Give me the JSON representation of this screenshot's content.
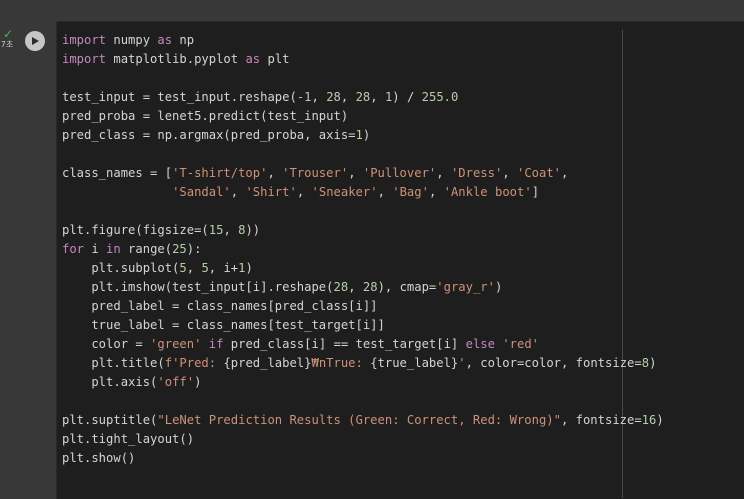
{
  "cell": {
    "status_time": "7초",
    "run_icon": "play-icon",
    "lines": [
      [
        [
          "kw",
          "import"
        ],
        [
          "pl",
          " numpy "
        ],
        [
          "kw",
          "as"
        ],
        [
          "pl",
          " np"
        ]
      ],
      [
        [
          "kw",
          "import"
        ],
        [
          "pl",
          " matplotlib.pyplot "
        ],
        [
          "kw",
          "as"
        ],
        [
          "pl",
          " plt"
        ]
      ],
      [],
      [
        [
          "pl",
          "test_input = test_input.reshape("
        ],
        [
          "num",
          "-1"
        ],
        [
          "pl",
          ", "
        ],
        [
          "num",
          "28"
        ],
        [
          "pl",
          ", "
        ],
        [
          "num",
          "28"
        ],
        [
          "pl",
          ", "
        ],
        [
          "num",
          "1"
        ],
        [
          "pl",
          ") / "
        ],
        [
          "num",
          "255.0"
        ]
      ],
      [
        [
          "pl",
          "pred_proba = lenet5.predict(test_input)"
        ]
      ],
      [
        [
          "pl",
          "pred_class = np.argmax(pred_proba, axis="
        ],
        [
          "num",
          "1"
        ],
        [
          "pl",
          ")"
        ]
      ],
      [],
      [
        [
          "pl",
          "class_names = ["
        ],
        [
          "str",
          "'T-shirt/top'"
        ],
        [
          "pl",
          ", "
        ],
        [
          "str",
          "'Trouser'"
        ],
        [
          "pl",
          ", "
        ],
        [
          "str",
          "'Pullover'"
        ],
        [
          "pl",
          ", "
        ],
        [
          "str",
          "'Dress'"
        ],
        [
          "pl",
          ", "
        ],
        [
          "str",
          "'Coat'"
        ],
        [
          "pl",
          ","
        ]
      ],
      [
        [
          "pl",
          "               "
        ],
        [
          "str",
          "'Sandal'"
        ],
        [
          "pl",
          ", "
        ],
        [
          "str",
          "'Shirt'"
        ],
        [
          "pl",
          ", "
        ],
        [
          "str",
          "'Sneaker'"
        ],
        [
          "pl",
          ", "
        ],
        [
          "str",
          "'Bag'"
        ],
        [
          "pl",
          ", "
        ],
        [
          "str",
          "'Ankle boot'"
        ],
        [
          "pl",
          "]"
        ]
      ],
      [],
      [
        [
          "pl",
          "plt.figure(figsize=("
        ],
        [
          "num",
          "15"
        ],
        [
          "pl",
          ", "
        ],
        [
          "num",
          "8"
        ],
        [
          "pl",
          "))"
        ]
      ],
      [
        [
          "kw",
          "for"
        ],
        [
          "pl",
          " i "
        ],
        [
          "kw",
          "in"
        ],
        [
          "pl",
          " range("
        ],
        [
          "num",
          "25"
        ],
        [
          "pl",
          "):"
        ]
      ],
      [
        [
          "pl",
          "    plt.subplot("
        ],
        [
          "num",
          "5"
        ],
        [
          "pl",
          ", "
        ],
        [
          "num",
          "5"
        ],
        [
          "pl",
          ", i+"
        ],
        [
          "num",
          "1"
        ],
        [
          "pl",
          ")"
        ]
      ],
      [
        [
          "pl",
          "    plt.imshow(test_input[i].reshape("
        ],
        [
          "num",
          "28"
        ],
        [
          "pl",
          ", "
        ],
        [
          "num",
          "28"
        ],
        [
          "pl",
          "), cmap="
        ],
        [
          "str",
          "'gray_r'"
        ],
        [
          "pl",
          ")"
        ]
      ],
      [
        [
          "pl",
          "    pred_label = class_names[pred_class[i]]"
        ]
      ],
      [
        [
          "pl",
          "    true_label = class_names[test_target[i]]"
        ]
      ],
      [
        [
          "pl",
          "    color = "
        ],
        [
          "str",
          "'green'"
        ],
        [
          "pl",
          " "
        ],
        [
          "kw",
          "if"
        ],
        [
          "pl",
          " pred_class[i] == test_target[i] "
        ],
        [
          "kw",
          "else"
        ],
        [
          "pl",
          " "
        ],
        [
          "str",
          "'red'"
        ]
      ],
      [
        [
          "pl",
          "    plt.title("
        ],
        [
          "str",
          "f'Pred: "
        ],
        [
          "pl",
          "{pred_label}"
        ],
        [
          "str",
          "₩nTrue: "
        ],
        [
          "pl",
          "{true_label}"
        ],
        [
          "str",
          "'"
        ],
        [
          "pl",
          ", color=color, fontsize="
        ],
        [
          "num",
          "8"
        ],
        [
          "pl",
          ")"
        ]
      ],
      [
        [
          "pl",
          "    plt.axis("
        ],
        [
          "str",
          "'off'"
        ],
        [
          "pl",
          ")"
        ]
      ],
      [],
      [
        [
          "pl",
          "plt.suptitle("
        ],
        [
          "str",
          "\"LeNet Prediction Results (Green: Correct, Red: Wrong)\""
        ],
        [
          "pl",
          ", fontsize="
        ],
        [
          "num",
          "16"
        ],
        [
          "pl",
          ")"
        ]
      ],
      [
        [
          "pl",
          "plt.tight_layout()"
        ]
      ],
      [
        [
          "pl",
          "plt.show()"
        ]
      ]
    ]
  }
}
